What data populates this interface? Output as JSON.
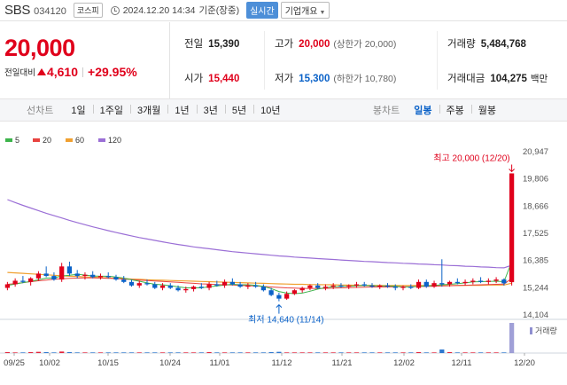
{
  "header": {
    "name": "SBS",
    "code": "034120",
    "market": "코스피",
    "datetime": "2024.12.20 14:34",
    "basis": "기준(장중)",
    "live_label": "실시간",
    "info_label": "기업개요"
  },
  "quote": {
    "price": "20,000",
    "change_label": "전일대비",
    "change_amount": "4,610",
    "change_pct": "+29.95%",
    "prev_close_label": "전일",
    "prev_close": "15,390",
    "open_label": "시가",
    "open": "15,440",
    "high_label": "고가",
    "high": "20,000",
    "upper_limit": "(상한가 20,000)",
    "low_label": "저가",
    "low": "15,300",
    "lower_limit": "(하한가 10,780)",
    "volume_label": "거래량",
    "volume": "5,484,768",
    "amount_label": "거래대금",
    "amount": "104,275",
    "amount_unit": "백만"
  },
  "toolbar": {
    "line_label": "선차트",
    "periods": [
      "1일",
      "1주일",
      "3개월",
      "1년",
      "3년",
      "5년",
      "10년"
    ],
    "candle_label": "봉차트",
    "candle_periods": [
      "일봉",
      "주봉",
      "월봉"
    ],
    "active_candle": "일봉"
  },
  "colors": {
    "up": "#e0001b",
    "down": "#0b62c8",
    "ma5": "#3cb44b",
    "ma20": "#e8423f",
    "ma60": "#f0a030",
    "ma120": "#9b6fd6"
  },
  "chart_data": {
    "type": "candlestick",
    "legend": [
      "5",
      "20",
      "60",
      "120"
    ],
    "y_ticks": [
      "20,947",
      "19,806",
      "18,666",
      "17,525",
      "16,385",
      "15,244",
      "14,104"
    ],
    "y_tick_values": [
      20947,
      19806,
      18666,
      17525,
      16385,
      15244,
      14104
    ],
    "x_ticks": [
      "09/25",
      "10/02",
      "10/15",
      "10/24",
      "11/01",
      "11/12",
      "11/21",
      "12/02",
      "12/11",
      "12/20"
    ],
    "max_label": "최고 20,000 (12/20)",
    "min_label": "최저 14,640 (11/14)",
    "volume_label": "거래량",
    "candles": [
      {
        "o": 15200,
        "h": 15450,
        "l": 15100,
        "c": 15350
      },
      {
        "o": 15350,
        "h": 15600,
        "l": 15250,
        "c": 15500
      },
      {
        "o": 15500,
        "h": 15700,
        "l": 15400,
        "c": 15450
      },
      {
        "o": 15450,
        "h": 15650,
        "l": 15300,
        "c": 15600
      },
      {
        "o": 15600,
        "h": 15900,
        "l": 15500,
        "c": 15800
      },
      {
        "o": 15800,
        "h": 16100,
        "l": 15650,
        "c": 15700
      },
      {
        "o": 15700,
        "h": 15850,
        "l": 15500,
        "c": 15550
      },
      {
        "o": 15550,
        "h": 16250,
        "l": 15450,
        "c": 16100
      },
      {
        "o": 16100,
        "h": 16300,
        "l": 15700,
        "c": 15800
      },
      {
        "o": 15800,
        "h": 15950,
        "l": 15600,
        "c": 15700
      },
      {
        "o": 15700,
        "h": 15850,
        "l": 15550,
        "c": 15750
      },
      {
        "o": 15750,
        "h": 15900,
        "l": 15600,
        "c": 15650
      },
      {
        "o": 15650,
        "h": 15800,
        "l": 15550,
        "c": 15700
      },
      {
        "o": 15700,
        "h": 15850,
        "l": 15600,
        "c": 15650
      },
      {
        "o": 15650,
        "h": 15750,
        "l": 15500,
        "c": 15550
      },
      {
        "o": 15550,
        "h": 15700,
        "l": 15400,
        "c": 15450
      },
      {
        "o": 15450,
        "h": 15550,
        "l": 15250,
        "c": 15300
      },
      {
        "o": 15300,
        "h": 15500,
        "l": 15200,
        "c": 15400
      },
      {
        "o": 15400,
        "h": 15550,
        "l": 15300,
        "c": 15350
      },
      {
        "o": 15350,
        "h": 15450,
        "l": 15150,
        "c": 15200
      },
      {
        "o": 15200,
        "h": 15400,
        "l": 15100,
        "c": 15300
      },
      {
        "o": 15300,
        "h": 15400,
        "l": 15150,
        "c": 15200
      },
      {
        "o": 15200,
        "h": 15300,
        "l": 15050,
        "c": 15100
      },
      {
        "o": 15100,
        "h": 15250,
        "l": 15000,
        "c": 15150
      },
      {
        "o": 15150,
        "h": 15300,
        "l": 15050,
        "c": 15250
      },
      {
        "o": 15250,
        "h": 15400,
        "l": 15150,
        "c": 15200
      },
      {
        "o": 15200,
        "h": 15450,
        "l": 15100,
        "c": 15350
      },
      {
        "o": 15350,
        "h": 15500,
        "l": 15250,
        "c": 15300
      },
      {
        "o": 15300,
        "h": 15550,
        "l": 15200,
        "c": 15450
      },
      {
        "o": 15450,
        "h": 15600,
        "l": 15300,
        "c": 15350
      },
      {
        "o": 15350,
        "h": 15450,
        "l": 15200,
        "c": 15250
      },
      {
        "o": 15250,
        "h": 15400,
        "l": 15150,
        "c": 15300
      },
      {
        "o": 15300,
        "h": 15450,
        "l": 15200,
        "c": 15250
      },
      {
        "o": 15250,
        "h": 15350,
        "l": 15050,
        "c": 15100
      },
      {
        "o": 15100,
        "h": 15200,
        "l": 14850,
        "c": 14900
      },
      {
        "o": 14900,
        "h": 15000,
        "l": 14640,
        "c": 14750
      },
      {
        "o": 14750,
        "h": 15050,
        "l": 14700,
        "c": 14950
      },
      {
        "o": 14950,
        "h": 15150,
        "l": 14900,
        "c": 15100
      },
      {
        "o": 15100,
        "h": 15250,
        "l": 15000,
        "c": 15200
      },
      {
        "o": 15200,
        "h": 15350,
        "l": 15100,
        "c": 15300
      },
      {
        "o": 15300,
        "h": 15400,
        "l": 15150,
        "c": 15200
      },
      {
        "o": 15200,
        "h": 15350,
        "l": 15100,
        "c": 15250
      },
      {
        "o": 15250,
        "h": 15400,
        "l": 15150,
        "c": 15300
      },
      {
        "o": 15300,
        "h": 15400,
        "l": 15200,
        "c": 15250
      },
      {
        "o": 15250,
        "h": 15350,
        "l": 15150,
        "c": 15300
      },
      {
        "o": 15300,
        "h": 15450,
        "l": 15200,
        "c": 15350
      },
      {
        "o": 15350,
        "h": 15450,
        "l": 15250,
        "c": 15300
      },
      {
        "o": 15300,
        "h": 15400,
        "l": 15200,
        "c": 15250
      },
      {
        "o": 15250,
        "h": 15350,
        "l": 15150,
        "c": 15300
      },
      {
        "o": 15300,
        "h": 15400,
        "l": 15200,
        "c": 15250
      },
      {
        "o": 15250,
        "h": 15350,
        "l": 15100,
        "c": 15200
      },
      {
        "o": 15200,
        "h": 15300,
        "l": 15100,
        "c": 15250
      },
      {
        "o": 15250,
        "h": 15350,
        "l": 15150,
        "c": 15200
      },
      {
        "o": 15200,
        "h": 15550,
        "l": 15150,
        "c": 15450
      },
      {
        "o": 15450,
        "h": 15550,
        "l": 15200,
        "c": 15250
      },
      {
        "o": 15250,
        "h": 15500,
        "l": 15200,
        "c": 15400
      },
      {
        "o": 15400,
        "h": 16400,
        "l": 15250,
        "c": 15350
      },
      {
        "o": 15350,
        "h": 15500,
        "l": 15250,
        "c": 15450
      },
      {
        "o": 15450,
        "h": 15600,
        "l": 15350,
        "c": 15400
      },
      {
        "o": 15400,
        "h": 15550,
        "l": 15300,
        "c": 15450
      },
      {
        "o": 15450,
        "h": 15600,
        "l": 15350,
        "c": 15500
      },
      {
        "o": 15500,
        "h": 15650,
        "l": 15400,
        "c": 15450
      },
      {
        "o": 15450,
        "h": 15600,
        "l": 15350,
        "c": 15500
      },
      {
        "o": 15500,
        "h": 15650,
        "l": 15400,
        "c": 15550
      },
      {
        "o": 15550,
        "h": 15600,
        "l": 15300,
        "c": 15390
      },
      {
        "o": 15440,
        "h": 20000,
        "l": 15300,
        "c": 20000
      }
    ],
    "volumes": [
      3,
      2,
      2,
      3,
      4,
      3,
      2,
      5,
      3,
      2,
      2,
      2,
      2,
      2,
      2,
      2,
      2,
      2,
      2,
      2,
      2,
      2,
      2,
      2,
      2,
      2,
      3,
      2,
      2,
      2,
      2,
      2,
      2,
      2,
      3,
      4,
      2,
      2,
      2,
      2,
      2,
      2,
      2,
      2,
      2,
      2,
      2,
      2,
      2,
      2,
      2,
      2,
      2,
      3,
      2,
      2,
      12,
      3,
      2,
      2,
      2,
      2,
      2,
      2,
      2,
      100
    ],
    "ma5": [
      15300,
      15360,
      15420,
      15470,
      15540,
      15610,
      15620,
      15700,
      15730,
      15770,
      15740,
      15700,
      15690,
      15690,
      15660,
      15610,
      15540,
      15480,
      15410,
      15350,
      15330,
      15290,
      15250,
      15200,
      15200,
      15200,
      15250,
      15280,
      15320,
      15350,
      15330,
      15330,
      15310,
      15260,
      15170,
      15050,
      14980,
      14960,
      14980,
      15060,
      15150,
      15210,
      15250,
      15260,
      15270,
      15290,
      15300,
      15290,
      15280,
      15280,
      15270,
      15240,
      15240,
      15270,
      15280,
      15300,
      15330,
      15350,
      15380,
      15410,
      15450,
      15460,
      15470,
      15480,
      15460,
      16300
    ],
    "ma20": [
      15350,
      15380,
      15420,
      15460,
      15500,
      15530,
      15560,
      15580,
      15600,
      15610,
      15620,
      15620,
      15610,
      15600,
      15590,
      15570,
      15550,
      15530,
      15510,
      15490,
      15470,
      15450,
      15430,
      15410,
      15390,
      15370,
      15360,
      15340,
      15330,
      15320,
      15300,
      15290,
      15280,
      15260,
      15240,
      15220,
      15200,
      15190,
      15180,
      15180,
      15180,
      15180,
      15190,
      15200,
      15210,
      15220,
      15230,
      15240,
      15240,
      15240,
      15250,
      15250,
      15250,
      15260,
      15260,
      15270,
      15280,
      15290,
      15300,
      15310,
      15320,
      15330,
      15340,
      15350,
      15360,
      15600
    ],
    "ma60": [
      15850,
      15830,
      15810,
      15790,
      15770,
      15750,
      15730,
      15710,
      15690,
      15680,
      15660,
      15650,
      15630,
      15620,
      15600,
      15590,
      15570,
      15560,
      15540,
      15530,
      15520,
      15510,
      15500,
      15490,
      15480,
      15470,
      15460,
      15450,
      15440,
      15430,
      15420,
      15410,
      15400,
      15390,
      15380,
      15370,
      15360,
      15350,
      15350,
      15340,
      15340,
      15330,
      15330,
      15320,
      15320,
      15310,
      15310,
      15310,
      15300,
      15300,
      15300,
      15300,
      15300,
      15300,
      15300,
      15300,
      15300,
      15300,
      15300,
      15310,
      15310,
      15310,
      15320,
      15320,
      15320,
      15400
    ],
    "ma120": [
      18900,
      18780,
      18660,
      18550,
      18440,
      18330,
      18230,
      18130,
      18030,
      17940,
      17850,
      17760,
      17680,
      17600,
      17520,
      17450,
      17380,
      17310,
      17250,
      17190,
      17130,
      17070,
      17020,
      16970,
      16920,
      16880,
      16840,
      16800,
      16760,
      16720,
      16690,
      16660,
      16630,
      16600,
      16570,
      16540,
      16520,
      16490,
      16470,
      16450,
      16430,
      16410,
      16390,
      16370,
      16350,
      16330,
      16310,
      16300,
      16280,
      16260,
      16250,
      16230,
      16220,
      16200,
      16190,
      16170,
      16160,
      16140,
      16130,
      16110,
      16100,
      16080,
      16070,
      16050,
      16040,
      16150
    ]
  }
}
